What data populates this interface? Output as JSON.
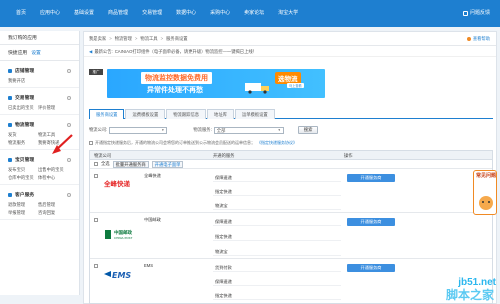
{
  "topnav": {
    "items": [
      "首页",
      "应用中心",
      "基础设置",
      "商品管理",
      "交易管理",
      "数据中心",
      "采购中心",
      "卖家论坛",
      "淘宝大学"
    ],
    "logout": "问题反馈"
  },
  "sidebar": {
    "title": "我订购的应用",
    "quick": "快捷应用",
    "quick_setting": "设置",
    "groups": [
      {
        "title": "店铺管理",
        "links": [
          "我要开店"
        ]
      },
      {
        "title": "交易管理",
        "links": [
          "已卖出的宝贝",
          "评价管理"
        ]
      },
      {
        "title": "物流管理",
        "links": [
          "发货",
          "物流工具",
          "物流服务",
          "我要寄快递"
        ]
      },
      {
        "title": "宝贝管理",
        "links": [
          "发布宝贝",
          "出售中的宝贝",
          "仓库中的宝贝",
          "体检中心"
        ]
      },
      {
        "title": "客户服务",
        "links": [
          "退款管理",
          "售后管理",
          "举报管理",
          "咨询回复"
        ]
      }
    ]
  },
  "breadcrumb": [
    "我是卖家",
    "物流管理",
    "物流工具",
    "服务商设置"
  ],
  "help": "查看帮助",
  "notice": {
    "label": "最新公告:",
    "text": "CAINIAO打印组件（电子面单必备，请更升级）物流监控—一键揭已上线！"
  },
  "banner": {
    "ad_tag": "推广",
    "line1": "物流监控数据免费用",
    "line2": "异常件处理不再愁",
    "logo_title": "选物流",
    "logo_sub": "马上查看"
  },
  "tabs": [
    "服务商设置",
    "运费模板设置",
    "物流跟踪信息",
    "地址库",
    "运单模板设置"
  ],
  "filter": {
    "company_label": "物流公司:",
    "company_value": "",
    "service_label": "物流服务:",
    "service_value": "全部",
    "search_button": "搜索"
  },
  "hint": {
    "text": "开通指定快递服务后，开通的物流公司会将您的订单推送到公示物流会员配送的运单信息；",
    "link": "《指定快递服务协议》"
  },
  "table": {
    "headers": [
      "物流公司",
      "开通的服务",
      "操作"
    ],
    "batch": {
      "select_all": "全选",
      "batch_open": "批量开通服务商",
      "open_esheet": "开通电子面单"
    },
    "rows": [
      {
        "name": "全峰快递",
        "logo": "全峰快递",
        "services": [
          "保障速递",
          "指定快递",
          "物流宝"
        ],
        "action": "开通服务商"
      },
      {
        "name": "中国邮政",
        "logo": "中国邮政",
        "logo_sub": "CHINA POST",
        "services": [
          "保障速递",
          "指定快递",
          "物流宝"
        ],
        "action": "开通服务商"
      },
      {
        "name": "EMS",
        "logo": "EMS",
        "services": [
          "货到付款",
          "保障速递",
          "指定快递"
        ],
        "action": "开通服务商"
      }
    ]
  },
  "float_widget": {
    "text": "常见问题"
  },
  "watermark": {
    "line1": "jb51.net",
    "line2": "脚本之家"
  },
  "colors": {
    "nav_blue": "#1e7fd0",
    "action_blue": "#3c8fe0",
    "accent_orange": "#f08a24"
  }
}
